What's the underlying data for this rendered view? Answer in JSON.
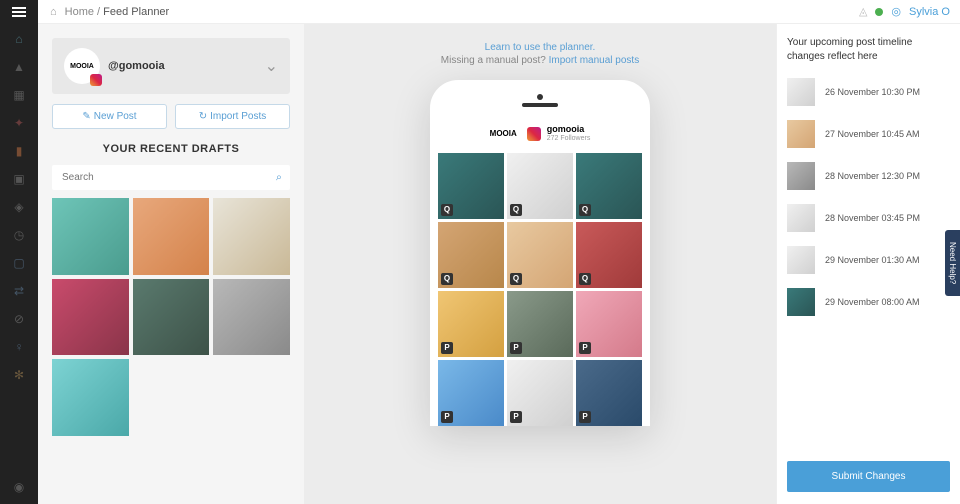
{
  "breadcrumb": {
    "home": "Home",
    "separator": " / ",
    "current": "Feed Planner"
  },
  "user": {
    "name": "Sylvia O"
  },
  "account": {
    "brand": "MOOIA",
    "handle": "@gomooia"
  },
  "buttons": {
    "newPost": "New Post",
    "importPosts": "Import Posts"
  },
  "drafts": {
    "title": "YOUR RECENT DRAFTS",
    "searchPlaceholder": "Search"
  },
  "hints": {
    "learn": "Learn to use the planner.",
    "missing": "Missing a manual post? ",
    "importLink": "Import manual posts"
  },
  "phone": {
    "brand": "MOOIA",
    "username": "gomooia",
    "followers": "272 Followers"
  },
  "phoneGrid": [
    {
      "badge": "Q"
    },
    {
      "badge": "Q"
    },
    {
      "badge": "Q"
    },
    {
      "badge": "Q"
    },
    {
      "badge": "Q"
    },
    {
      "badge": "Q"
    },
    {
      "badge": "P"
    },
    {
      "badge": "P"
    },
    {
      "badge": "P"
    },
    {
      "badge": "P"
    },
    {
      "badge": "P"
    },
    {
      "badge": "P"
    }
  ],
  "timeline": {
    "title": "Your upcoming post timeline changes reflect here",
    "items": [
      {
        "date": "26 November 10:30 PM"
      },
      {
        "date": "27 November 10:45 AM"
      },
      {
        "date": "28 November 12:30 PM"
      },
      {
        "date": "28 November 03:45 PM"
      },
      {
        "date": "29 November 01:30 AM"
      },
      {
        "date": "29 November 08:00 AM"
      }
    ],
    "submit": "Submit Changes"
  },
  "help": "Need Help?"
}
